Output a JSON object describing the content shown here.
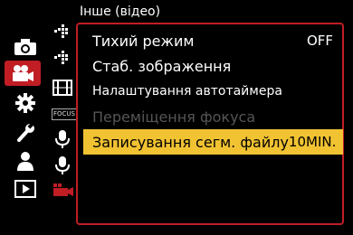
{
  "menu": {
    "title": "Інше (відео)",
    "items": [
      {
        "label": "Тихий режим",
        "value": "OFF",
        "state": "normal"
      },
      {
        "label": "Стаб. зображення",
        "value": "",
        "state": "normal"
      },
      {
        "label": "Налаштування автотаймера",
        "value": "",
        "state": "normal"
      },
      {
        "label": "Переміщення фокуса",
        "value": "",
        "state": "disabled"
      },
      {
        "label": "Записування сегм. файлу",
        "value": "10MIN.",
        "state": "selected"
      }
    ]
  },
  "sidebar": {
    "main_tabs": [
      "camera-icon",
      "video-camera-icon",
      "gear-icon",
      "wrench-icon",
      "person-icon",
      "playback-icon"
    ],
    "sub_tabs": [
      "image-quality-icon",
      "image-quality-plus-icon",
      "film-strip-icon",
      "focus-icon",
      "microphone-icon",
      "microphone-plus-icon",
      "video-sub-icon"
    ],
    "focus_icon_text": "FOCUS"
  },
  "colors": {
    "accent_red": "#c01d24",
    "selected_yellow": "#f1c232",
    "disabled_gray": "#555555"
  }
}
